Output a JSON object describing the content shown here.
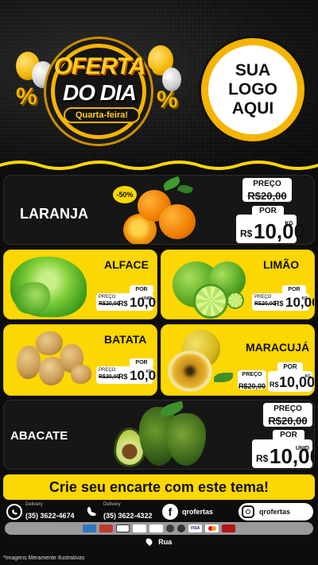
{
  "header": {
    "badge_title_1": "OFERTA",
    "badge_title_2": "DO DIA",
    "badge_day": "Quarta-feira!",
    "percent_symbol": "%",
    "logo_lines": [
      "SUA",
      "LOGO",
      "AQUI"
    ]
  },
  "products": {
    "laranja": {
      "name": "LARANJA",
      "discount": "-50%",
      "old_label": "PREÇO",
      "old_price": "R$20,00",
      "por": "POR",
      "currency": "R$",
      "price": "10,00",
      "unit": "KG"
    },
    "alface": {
      "name": "ALFACE",
      "old_label": "PREÇO",
      "old_price": "R$20,00",
      "por": "POR",
      "currency": "R$",
      "price": "10,00",
      "unit": "UNID"
    },
    "limao": {
      "name": "LIMÃO",
      "old_label": "PREÇO",
      "old_price": "R$20,00",
      "por": "POR",
      "currency": "R$",
      "price": "10,00",
      "unit": "KG"
    },
    "batata": {
      "name": "BATATA",
      "old_label": "PREÇO",
      "old_price": "R$20,00",
      "por": "POR",
      "currency": "R$",
      "price": "10,00",
      "unit": "KG"
    },
    "maracuja": {
      "name": "MARACUJÁ",
      "old_label": "PREÇO",
      "old_price": "R$20,00",
      "por": "POR",
      "currency": "R$",
      "price": "10,00",
      "unit": "KG"
    },
    "abacate": {
      "name": "ABACATE",
      "old_label": "PREÇO",
      "old_price": "R$20,00",
      "por": "POR",
      "currency": "R$",
      "price": "10,00",
      "unit": "UNID"
    }
  },
  "banner": {
    "text": "Crie seu encarte com este tema!"
  },
  "contacts": {
    "delivery_label": "Delivery",
    "whatsapp_number": "(35) 3622-4674",
    "phone_number": "(35) 3622-4322",
    "facebook_handle": "qrofertas",
    "instagram_handle": "qrofertas"
  },
  "payment_methods": [
    "AMEX",
    "ELO",
    "BOLETO",
    "PIX",
    "TICKET",
    "DINHEIRO",
    "VISA",
    "MASTERCARD",
    "HIPERCARD"
  ],
  "address": {
    "label": "Rua"
  },
  "disclaimer": "*Imagens Meramente Ilustrativas",
  "colors": {
    "accent_yellow": "#fcd702",
    "background": "#0d0d0d",
    "card_dark": "#161616"
  }
}
